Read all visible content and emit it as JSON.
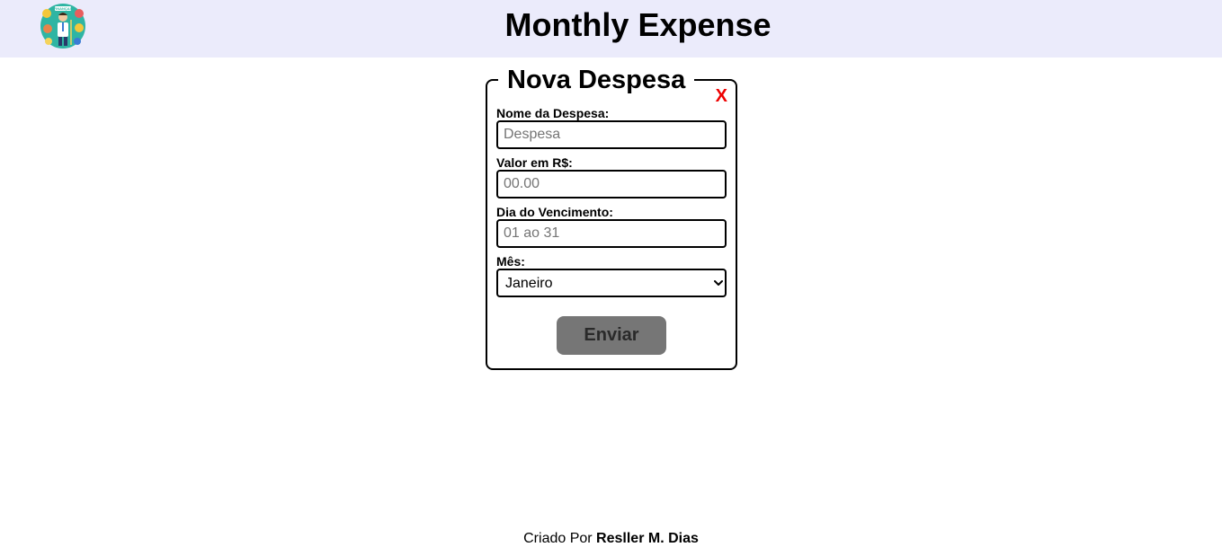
{
  "header": {
    "title": "Monthly Expense",
    "logo_icon": "finance-character-logo",
    "logo_text": "FINANÇAS"
  },
  "form": {
    "legend": "Nova Despesa",
    "close_label": "X",
    "fields": {
      "name": {
        "label": "Nome da Despesa:",
        "placeholder": "Despesa",
        "value": ""
      },
      "value": {
        "label": "Valor em R$:",
        "placeholder": "00.00",
        "value": ""
      },
      "due_day": {
        "label": "Dia do Vencimento:",
        "placeholder": "01 ao 31",
        "value": ""
      },
      "month": {
        "label": "Mês:",
        "selected": "Janeiro"
      }
    },
    "submit_label": "Enviar"
  },
  "footer": {
    "prefix": "Criado Por ",
    "author": "Resller M. Dias"
  },
  "colors": {
    "header_bg": "#ebebfb",
    "close": "#ee0000",
    "button_bg": "#767676",
    "logo_bg": "#2fb5a3"
  }
}
